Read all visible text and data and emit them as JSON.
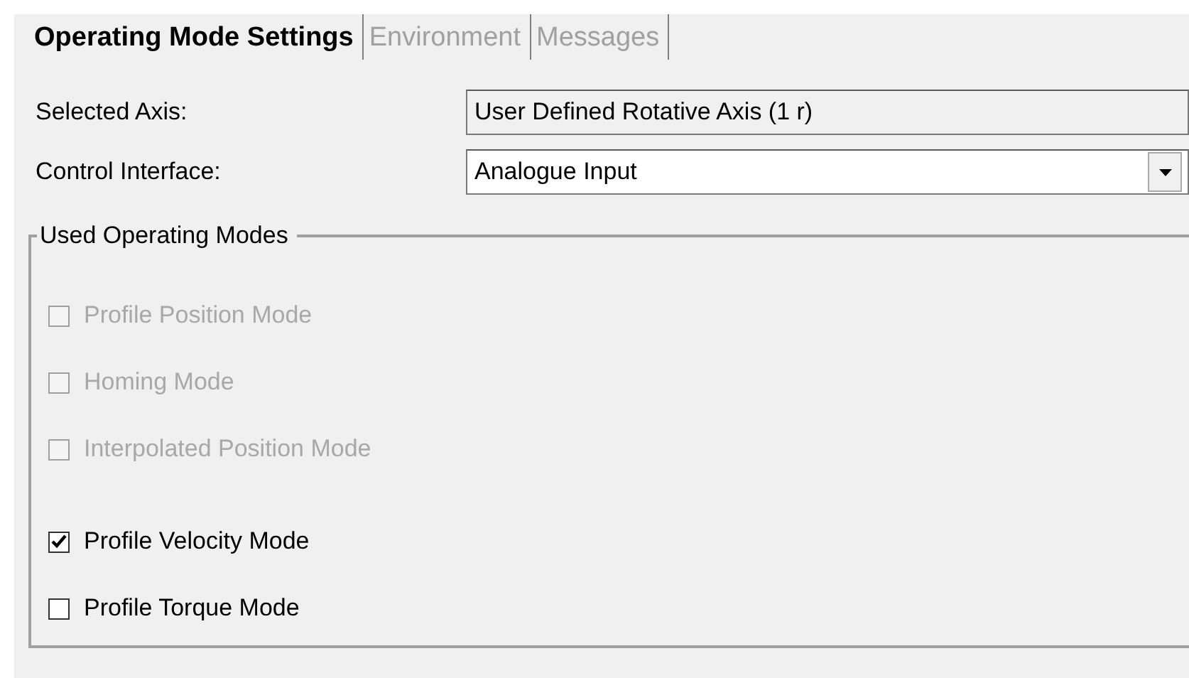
{
  "tabs": [
    {
      "label": "Operating Mode Settings",
      "selected": true
    },
    {
      "label": "Environment",
      "selected": false
    },
    {
      "label": "Messages",
      "selected": false
    }
  ],
  "fields": [
    {
      "label": "Selected Axis:",
      "value": "User Defined Rotative Axis (1 r)",
      "kind": "readonly"
    },
    {
      "label": "Control Interface:",
      "value": "Analogue Input",
      "kind": "dropdown"
    }
  ],
  "group": {
    "title": "Used Operating Modes",
    "modes": [
      {
        "label": "Profile Position Mode",
        "checked": false,
        "disabled": true
      },
      {
        "label": "Homing Mode",
        "checked": false,
        "disabled": true
      },
      {
        "label": "Interpolated Position Mode",
        "checked": false,
        "disabled": true
      },
      {
        "label": "Profile Velocity Mode",
        "checked": true,
        "disabled": false
      },
      {
        "label": "Profile Torque Mode",
        "checked": false,
        "disabled": false
      }
    ]
  }
}
